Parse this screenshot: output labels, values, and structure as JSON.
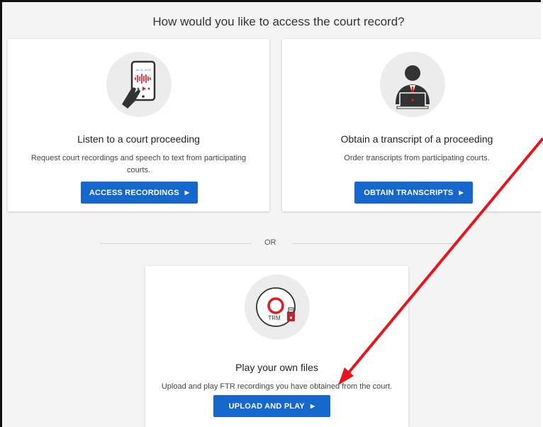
{
  "heading": "How would you like to access the court record?",
  "cards": [
    {
      "icon": "tablet-audio-icon",
      "title": "Listen to a court proceeding",
      "description": "Request court recordings and speech to text from participating courts.",
      "button_label": "ACCESS RECORDINGS",
      "screen_date": "Jul 24, 2018"
    },
    {
      "icon": "person-laptop-icon",
      "title": "Obtain a transcript of a proceeding",
      "description": "Order transcripts from participating courts.",
      "button_label": "OBTAIN TRANSCRIPTS"
    },
    {
      "icon": "trm-disc-usb-icon",
      "title": "Play your own files",
      "description": "Upload and play FTR recordings you have obtained from the court.",
      "button_label": "UPLOAD AND PLAY",
      "disc_label": "TRM"
    }
  ],
  "divider_text": "OR",
  "colors": {
    "accent": "#1667cc",
    "annotation": "#e8141b",
    "card_bg": "#ffffff",
    "page_bg": "#f4f4f4"
  }
}
